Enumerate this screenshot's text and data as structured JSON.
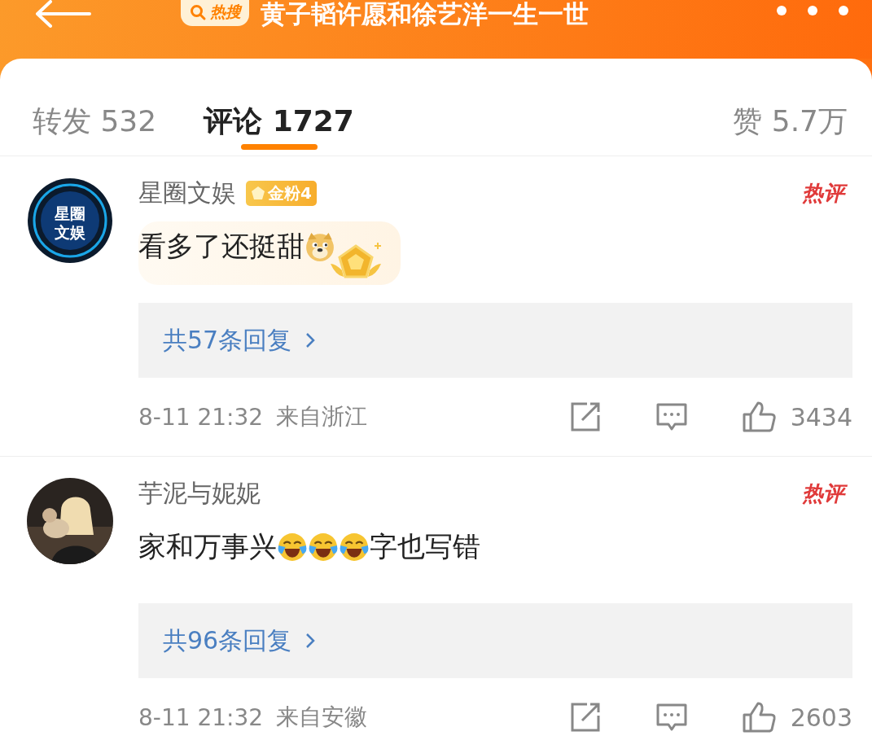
{
  "header": {
    "badge": "热搜",
    "title": "黄子韬许愿和徐艺洋一生一世"
  },
  "tabs": [
    {
      "label": "转发 532",
      "selected": false
    },
    {
      "label": "评论 1727",
      "selected": true
    },
    {
      "label": "赞 5.7万",
      "selected": false
    }
  ],
  "comments": [
    {
      "avatar": {
        "kind": "logo",
        "text": "星圈文娱"
      },
      "user": "星圈文娱",
      "badge": "金粉4",
      "hot_label": "热评",
      "highlighted": true,
      "content": [
        {
          "kind": "text",
          "text": "看多了还挺甜"
        },
        {
          "kind": "doge"
        }
      ],
      "replies": "共57条回复",
      "time": "8-11 21:32",
      "location": "来自浙江",
      "likes": "3434"
    },
    {
      "user": "芋泥与妮妮",
      "hot_label": "热评",
      "highlighted": false,
      "content": [
        {
          "kind": "text",
          "text": "家和万事兴"
        },
        {
          "kind": "laugh-cry"
        },
        {
          "kind": "laugh-cry"
        },
        {
          "kind": "laugh-cry"
        },
        {
          "kind": "text",
          "text": "字也写错"
        }
      ],
      "replies": "共96条回复",
      "time": "8-11 21:32",
      "location": "来自安徽",
      "likes": "2603"
    }
  ]
}
